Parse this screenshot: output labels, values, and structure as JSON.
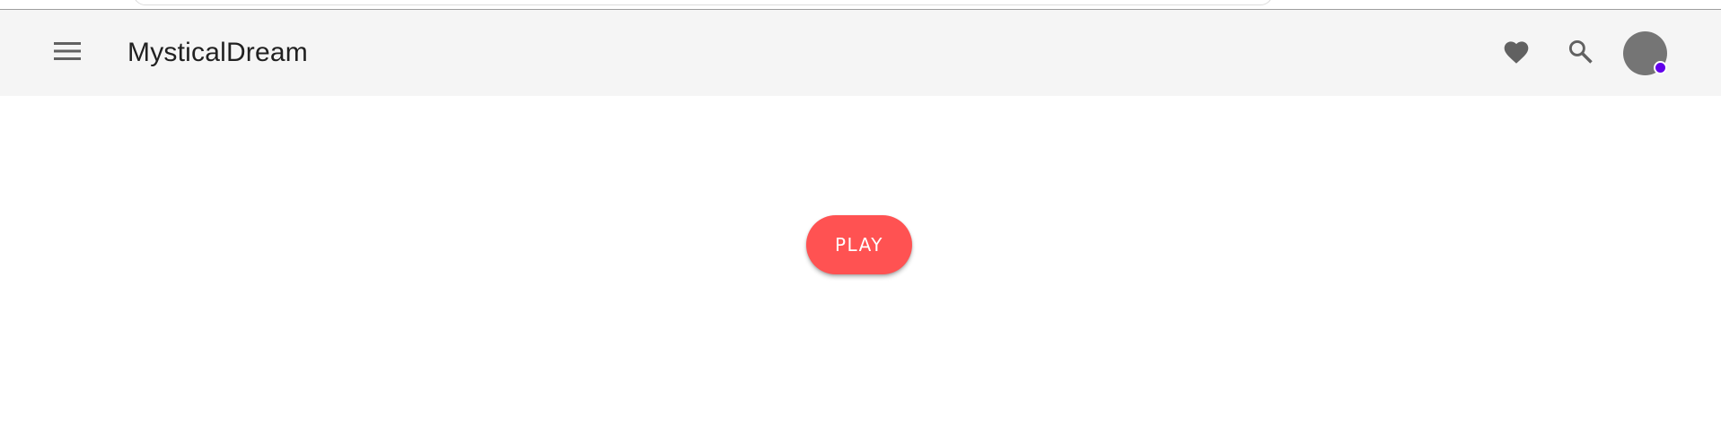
{
  "app_bar": {
    "title": "MysticalDream",
    "background_color": "#f5f5f5",
    "menu_icon": "hamburger-menu-icon",
    "actions": [
      {
        "icon": "heart-icon"
      },
      {
        "icon": "search-icon"
      }
    ],
    "avatar": {
      "color": "#757575",
      "status_dot_color": "#6200ea"
    }
  },
  "main": {
    "play_button": {
      "label": "PLAY",
      "color": "#ff5252"
    }
  }
}
